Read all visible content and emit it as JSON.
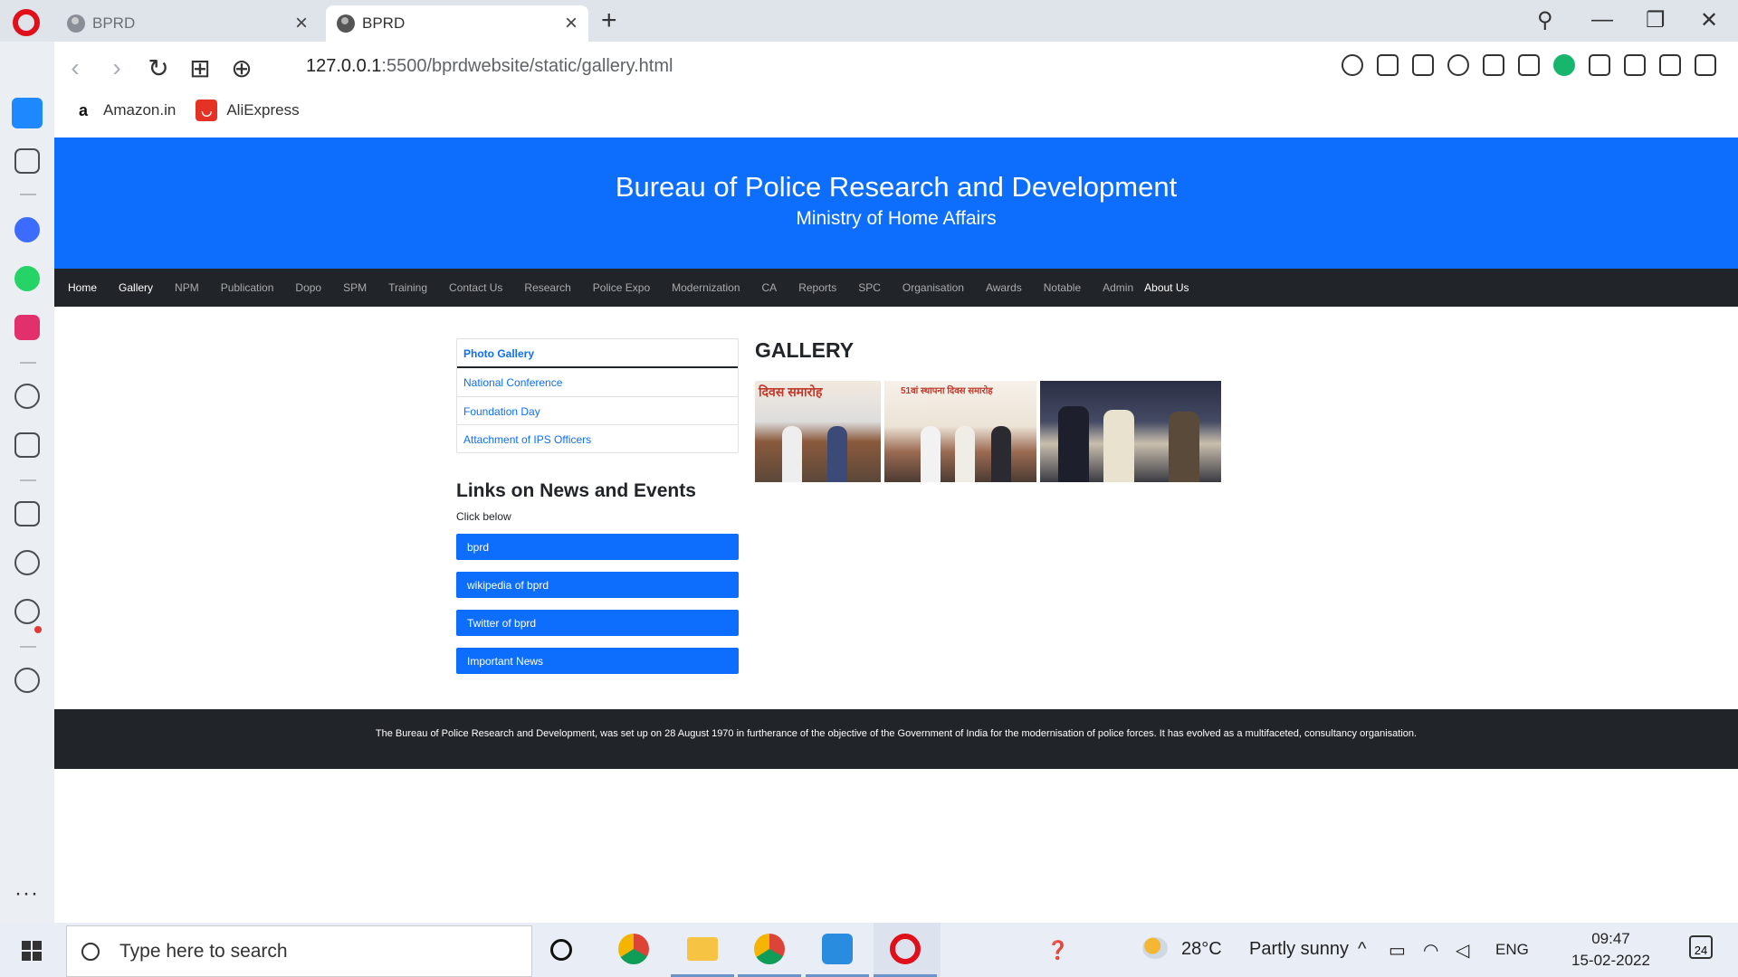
{
  "browser": {
    "tabs": [
      {
        "title": "BPRD",
        "active": false
      },
      {
        "title": "BPRD",
        "active": true
      }
    ],
    "url_host": "127.0.0.1",
    "url_path": ":5500/bprdwebsite/static/gallery.html",
    "bookmarks": [
      {
        "label": "Amazon.in",
        "icon": "amazon-icon"
      },
      {
        "label": "AliExpress",
        "icon": "aliexpress-icon"
      }
    ]
  },
  "site": {
    "title": "Bureau of Police Research and Development",
    "subtitle": "Ministry of Home Affairs",
    "nav": [
      "Home",
      "Gallery",
      "NPM",
      "Publication",
      "Dopo",
      "SPM",
      "Training",
      "Contact Us",
      "Research",
      "Police Expo",
      "Modernization",
      "CA",
      "Reports",
      "SPC",
      "Organisation",
      "Awards",
      "Notable",
      "Admin",
      "About Us"
    ],
    "nav_active": "Gallery",
    "sidebar_list": [
      "Photo Gallery",
      "National Conference",
      "Foundation Day",
      "Attachment of IPS Officers"
    ],
    "links_title": "Links on News and Events",
    "links_sub": "Click below",
    "links": [
      "bprd",
      "wikipedia of bprd",
      "Twitter of bprd",
      "Important News"
    ],
    "gallery_title": "GALLERY",
    "photo_captions": [
      "दिवस समारोह",
      "51वां स्थापना दिवस समारोह"
    ],
    "footer_text": "The Bureau of Police Research and Development, was set up on 28 August 1970 in furtherance of the objective of the Government of India for the modernisation of police forces. It has evolved as a multifaceted, consultancy organisation."
  },
  "taskbar": {
    "search_placeholder": "Type here to search",
    "temperature": "28°C",
    "weather": "Partly sunny",
    "language": "ENG",
    "time": "09:47",
    "date": "15-02-2022",
    "notification_count": "24"
  },
  "colors": {
    "brand_blue": "#0d6efd",
    "nav_dark": "#212529",
    "opera_red": "#e0101a"
  }
}
